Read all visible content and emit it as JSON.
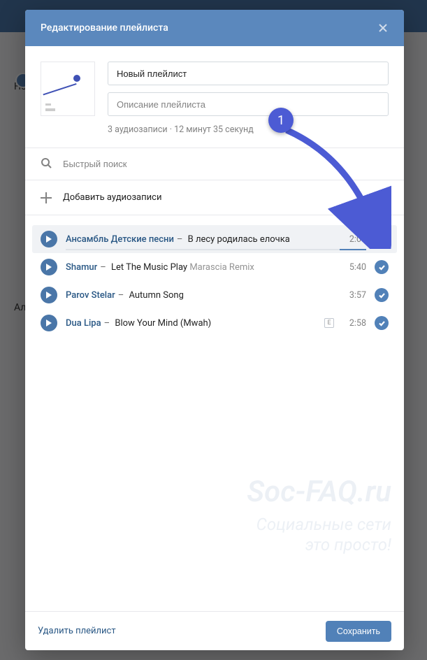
{
  "bg": {
    "line1": "Но",
    "line2": "Але"
  },
  "modal": {
    "title": "Редактирование плейлиста",
    "playlist_name_value": "Новый плейлист",
    "description_placeholder": "Описание плейлиста",
    "audio_count_text": "3 аудиозаписи",
    "duration_text": "12 минут 35 секунд"
  },
  "search": {
    "placeholder": "Быстрый поиск"
  },
  "add": {
    "label": "Добавить аудиозаписи"
  },
  "tracks": [
    {
      "artist": "Ансамбль Детские песни",
      "title": "В лесу родилась елочка",
      "subtitle": "",
      "duration": "2:09",
      "explicit": false,
      "selected": false,
      "hover": true
    },
    {
      "artist": "Shamur",
      "title": "Let The Music Play",
      "subtitle": "Marascia Remix",
      "duration": "5:40",
      "explicit": false,
      "selected": true,
      "hover": false
    },
    {
      "artist": "Parov Stelar",
      "title": "Autumn Song",
      "subtitle": "",
      "duration": "3:57",
      "explicit": false,
      "selected": true,
      "hover": false
    },
    {
      "artist": "Dua Lipa",
      "title": "Blow Your Mind (Mwah)",
      "subtitle": "",
      "duration": "2:58",
      "explicit": true,
      "selected": true,
      "hover": false
    }
  ],
  "footer": {
    "delete": "Удалить плейлист",
    "save": "Сохранить"
  },
  "annotation": {
    "label": "1"
  },
  "watermark": {
    "line1": "Soc-FAQ.ru",
    "line2": "Социальные сети",
    "line3": "это просто!"
  }
}
